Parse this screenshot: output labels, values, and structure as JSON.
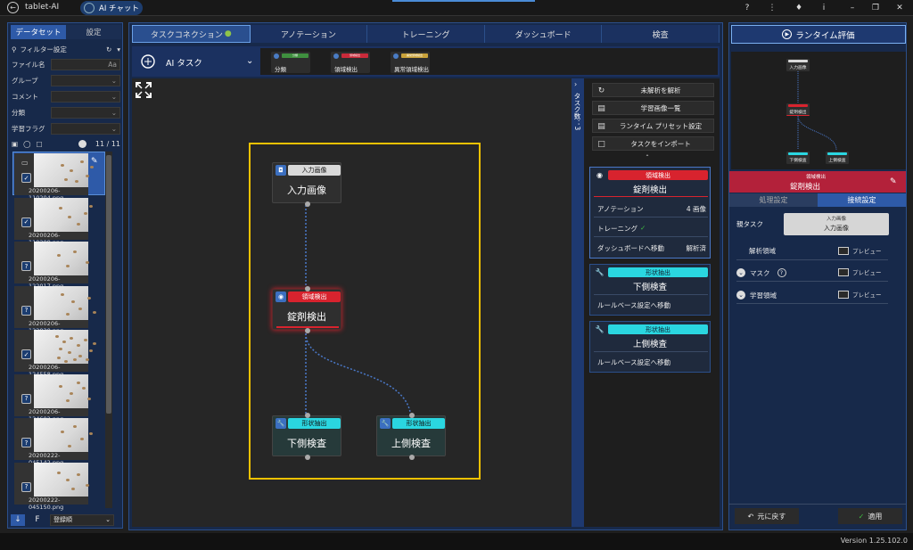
{
  "app": {
    "name": "tablet-AI",
    "ai_tab": "AI チャット"
  },
  "sidebar": {
    "tabs": [
      "データセット",
      "設定"
    ],
    "filter_label": "フィルター設定",
    "rows": [
      {
        "label": "ファイル名",
        "suffix": "Aa"
      },
      {
        "label": "グループ",
        "suffix": "⌄"
      },
      {
        "label": "コメント",
        "suffix": "⌄"
      },
      {
        "label": "分類",
        "suffix": "⌄"
      },
      {
        "label": "学習フラグ",
        "suffix": "⌄"
      }
    ],
    "count": "11 / 11",
    "images": [
      "20200206-110204.png",
      "20200206-110208.png",
      "20200206-122017.png",
      "20200206-122020.png",
      "20200206-124558.png",
      "20200206-124602.png",
      "20200222-045142.png",
      "20200222-045150.png"
    ],
    "sort_select": "登録順"
  },
  "nav": {
    "tabs": [
      "タスクコネクション",
      "アノテーション",
      "トレーニング",
      "ダッシュボード",
      "検査"
    ]
  },
  "taskbar": {
    "label": "AI タスク",
    "chips": [
      {
        "badge": "分類",
        "name": "分類",
        "color": "#3f8f3f"
      },
      {
        "badge": "領域検出",
        "name": "領域検出",
        "color": "#c92a3a"
      },
      {
        "badge": "異常領域検出",
        "name": "異常領域検出",
        "color": "#c9a23a"
      }
    ]
  },
  "graph": {
    "nodes": [
      {
        "badge": "入力画像",
        "name": "入力画像",
        "badge_color": "#d9d9d9"
      },
      {
        "badge": "領域検出",
        "name": "錠剤検出",
        "badge_color": "#d8232e"
      },
      {
        "badge": "形状抽出",
        "name": "下側検査",
        "badge_color": "#2ad6e0"
      },
      {
        "badge": "形状抽出",
        "name": "上側検査",
        "badge_color": "#2ad6e0"
      }
    ]
  },
  "tasklist": {
    "collapse_label": "タスク数：3",
    "actions": [
      "未解析を解析",
      "学習画像一覧",
      "ランタイム プリセット設定",
      "タスクをインポート"
    ],
    "cards": [
      {
        "badge": "領域検出",
        "name": "錠剤検出",
        "annotation_label": "アノテーション",
        "annotation_value": "4 画像",
        "training_label": "トレーニング",
        "dashboard_label": "ダッシュボードへ移動",
        "dashboard_value": "解析済"
      },
      {
        "badge": "形状抽出",
        "name": "下側検査",
        "link": "ルールベース設定へ移動"
      },
      {
        "badge": "形状抽出",
        "name": "上側検査",
        "link": "ルールベース設定へ移動"
      }
    ]
  },
  "right": {
    "runtime_button": "ランタイム評価",
    "minimap": [
      "入力画像",
      "錠剤検出",
      "下側検査",
      "上側検査"
    ],
    "selected": {
      "badge": "領域検出",
      "name": "錠剤検出"
    },
    "subtabs": [
      "処理設定",
      "接続設定"
    ],
    "parent_label": "親タスク",
    "parent_badge": "入力画像",
    "parent_name": "入力画像",
    "rows": [
      {
        "label": "解析領域",
        "action": "プレビュー"
      },
      {
        "label": "マスク",
        "action": "プレビュー"
      },
      {
        "label": "学習領域",
        "action": "プレビュー"
      }
    ],
    "back_button": "元に戻す",
    "apply_button": "適用"
  },
  "version": "Version 1.25.102.0"
}
